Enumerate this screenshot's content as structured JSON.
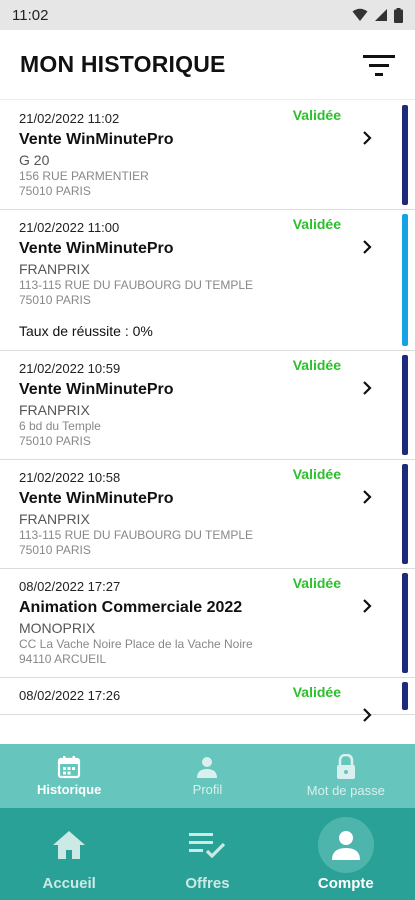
{
  "statusbar": {
    "time": "11:02"
  },
  "header": {
    "title": "MON HISTORIQUE"
  },
  "colors": {
    "validated": "#2cc02c",
    "bar_dark": "#1c2b7a",
    "bar_light": "#15a3e3",
    "subtab_bg": "#66c5bd",
    "nav_bg": "#2aa196"
  },
  "history": [
    {
      "date": "21/02/2022 11:02",
      "status": "Validée",
      "name": "Vente WinMinutePro",
      "store": "G 20",
      "address1": "156 RUE PARMENTIER",
      "address2": "75010 PARIS",
      "extra": "",
      "bar": "dark"
    },
    {
      "date": "21/02/2022 11:00",
      "status": "Validée",
      "name": "Vente WinMinutePro",
      "store": "FRANPRIX",
      "address1": "113-115 RUE DU FAUBOURG DU TEMPLE",
      "address2": "75010 PARIS",
      "extra": "Taux de réussite : 0%",
      "bar": "light"
    },
    {
      "date": "21/02/2022 10:59",
      "status": "Validée",
      "name": "Vente WinMinutePro",
      "store": "FRANPRIX",
      "address1": "6 bd du Temple",
      "address2": "75010 PARIS",
      "extra": "",
      "bar": "dark"
    },
    {
      "date": "21/02/2022 10:58",
      "status": "Validée",
      "name": "Vente WinMinutePro",
      "store": "FRANPRIX",
      "address1": "113-115 RUE DU FAUBOURG DU TEMPLE",
      "address2": "75010 PARIS",
      "extra": "",
      "bar": "dark"
    },
    {
      "date": "08/02/2022 17:27",
      "status": "Validée",
      "name": "Animation Commerciale 2022",
      "store": "MONOPRIX",
      "address1": "CC La Vache Noire Place de la Vache Noire",
      "address2": "94110 ARCUEIL",
      "extra": "",
      "bar": "dark"
    },
    {
      "date": "08/02/2022 17:26",
      "status": "Validée",
      "name": "",
      "store": "",
      "address1": "",
      "address2": "",
      "extra": "",
      "bar": "dark"
    }
  ],
  "subtabs": [
    {
      "label": "Historique",
      "icon": "calendar-icon",
      "active": true
    },
    {
      "label": "Profil",
      "icon": "person-icon",
      "active": false
    },
    {
      "label": "Mot de passe",
      "icon": "lock-icon",
      "active": false
    }
  ],
  "nav": [
    {
      "label": "Accueil",
      "icon": "home-icon",
      "active": false
    },
    {
      "label": "Offres",
      "icon": "checklist-icon",
      "active": false
    },
    {
      "label": "Compte",
      "icon": "account-icon",
      "active": true
    }
  ]
}
